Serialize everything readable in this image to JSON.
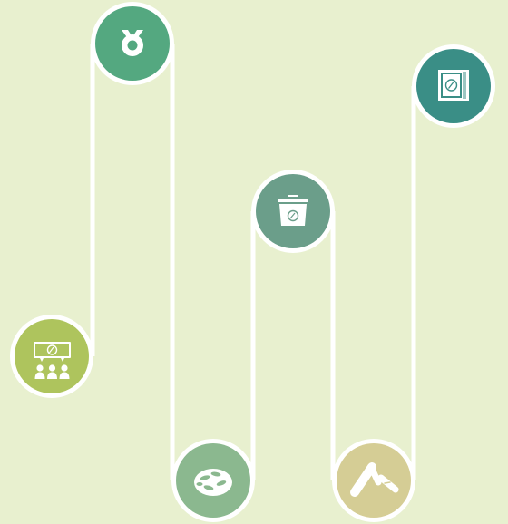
{
  "diagram": {
    "background": "#e8f0cf",
    "path_color": "#ffffff",
    "nodes": [
      {
        "id": "presentation",
        "icon": "presentation-board-audience-icon",
        "color": "#aec45d"
      },
      {
        "id": "medal",
        "icon": "medal-ribbon-icon",
        "color": "#54a880"
      },
      {
        "id": "seeds",
        "icon": "bowl-of-seeds-icon",
        "color": "#8bb88f"
      },
      {
        "id": "container",
        "icon": "container-with-logo-icon",
        "color": "#6b9e8a"
      },
      {
        "id": "products",
        "icon": "tubes-products-icon",
        "color": "#d5cd95"
      },
      {
        "id": "book",
        "icon": "book-with-logo-icon",
        "color": "#3a8e86"
      }
    ]
  }
}
